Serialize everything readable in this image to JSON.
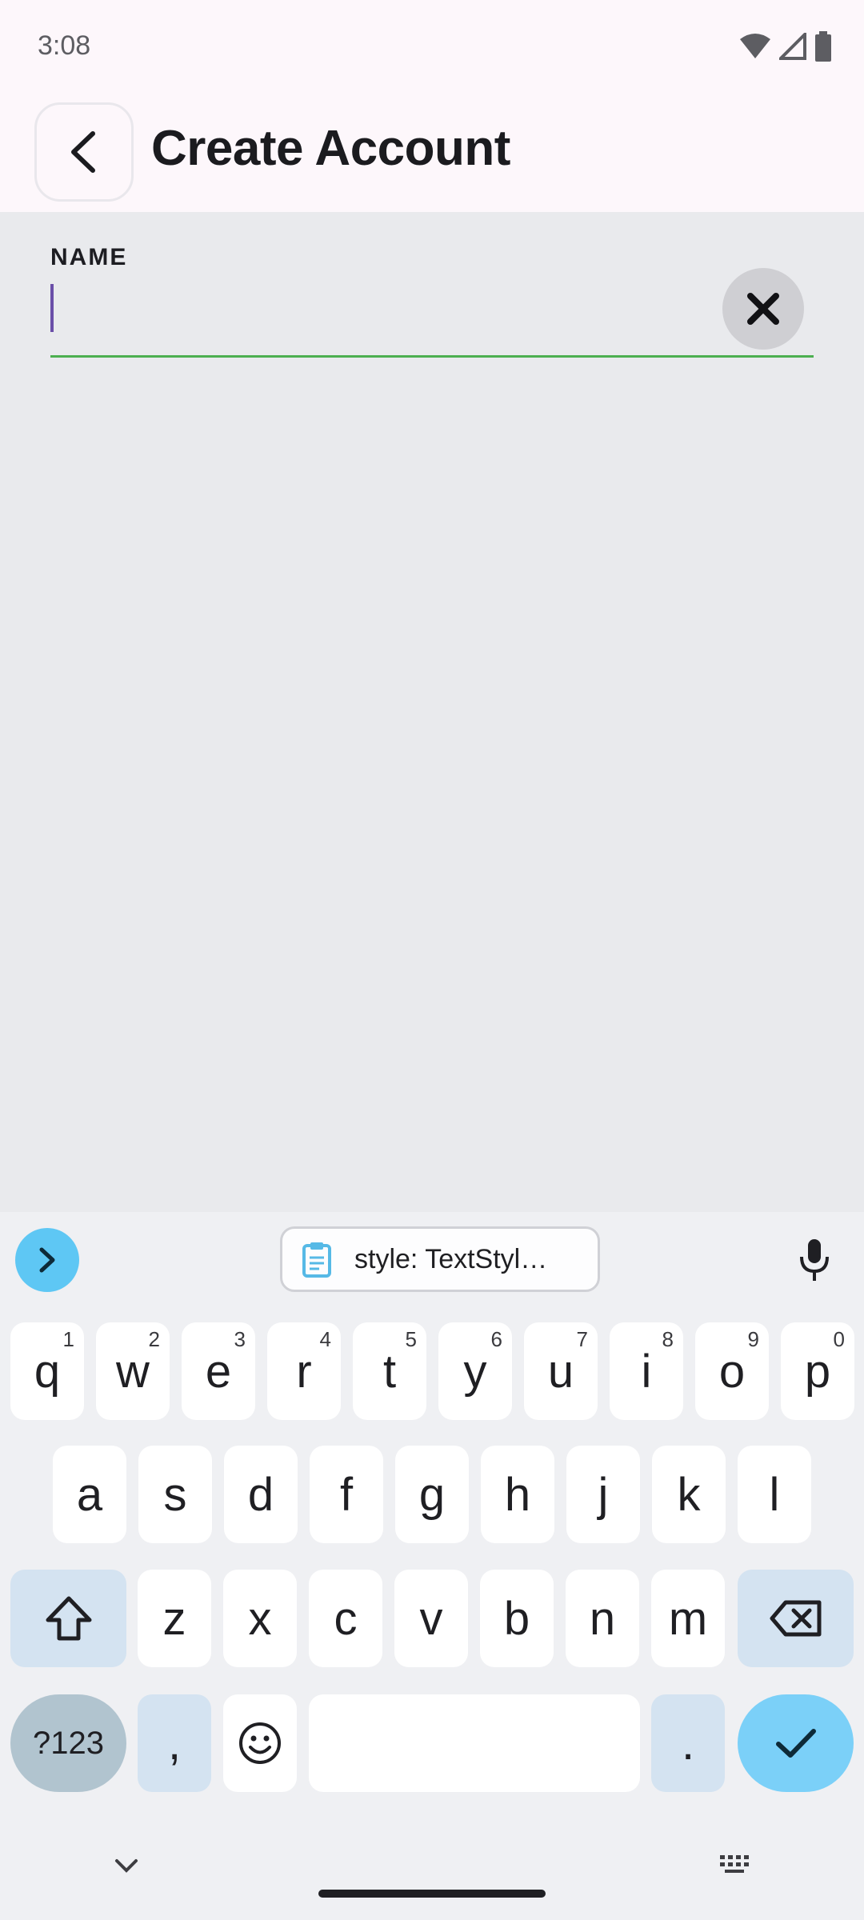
{
  "status": {
    "time": "3:08",
    "icons": [
      "wifi-icon",
      "signal-icon",
      "battery-icon"
    ]
  },
  "header": {
    "title": "Create Account",
    "back_icon": "chevron-left-icon"
  },
  "form": {
    "name_label": "NAME",
    "name_value": "",
    "clear_icon": "close-icon"
  },
  "keyboard": {
    "clipboard_suggestion": "style: TextStyl…",
    "row1": [
      {
        "k": "q",
        "h": "1"
      },
      {
        "k": "w",
        "h": "2"
      },
      {
        "k": "e",
        "h": "3"
      },
      {
        "k": "r",
        "h": "4"
      },
      {
        "k": "t",
        "h": "5"
      },
      {
        "k": "y",
        "h": "6"
      },
      {
        "k": "u",
        "h": "7"
      },
      {
        "k": "i",
        "h": "8"
      },
      {
        "k": "o",
        "h": "9"
      },
      {
        "k": "p",
        "h": "0"
      }
    ],
    "row2": [
      "a",
      "s",
      "d",
      "f",
      "g",
      "h",
      "j",
      "k",
      "l"
    ],
    "row3": [
      "z",
      "x",
      "c",
      "v",
      "b",
      "n",
      "m"
    ],
    "symbols_label": "?123",
    "comma": ",",
    "period": "."
  },
  "colors": {
    "accent": "#7bd0f8",
    "underline": "#4caf50",
    "cursor": "#6a4fa8"
  }
}
